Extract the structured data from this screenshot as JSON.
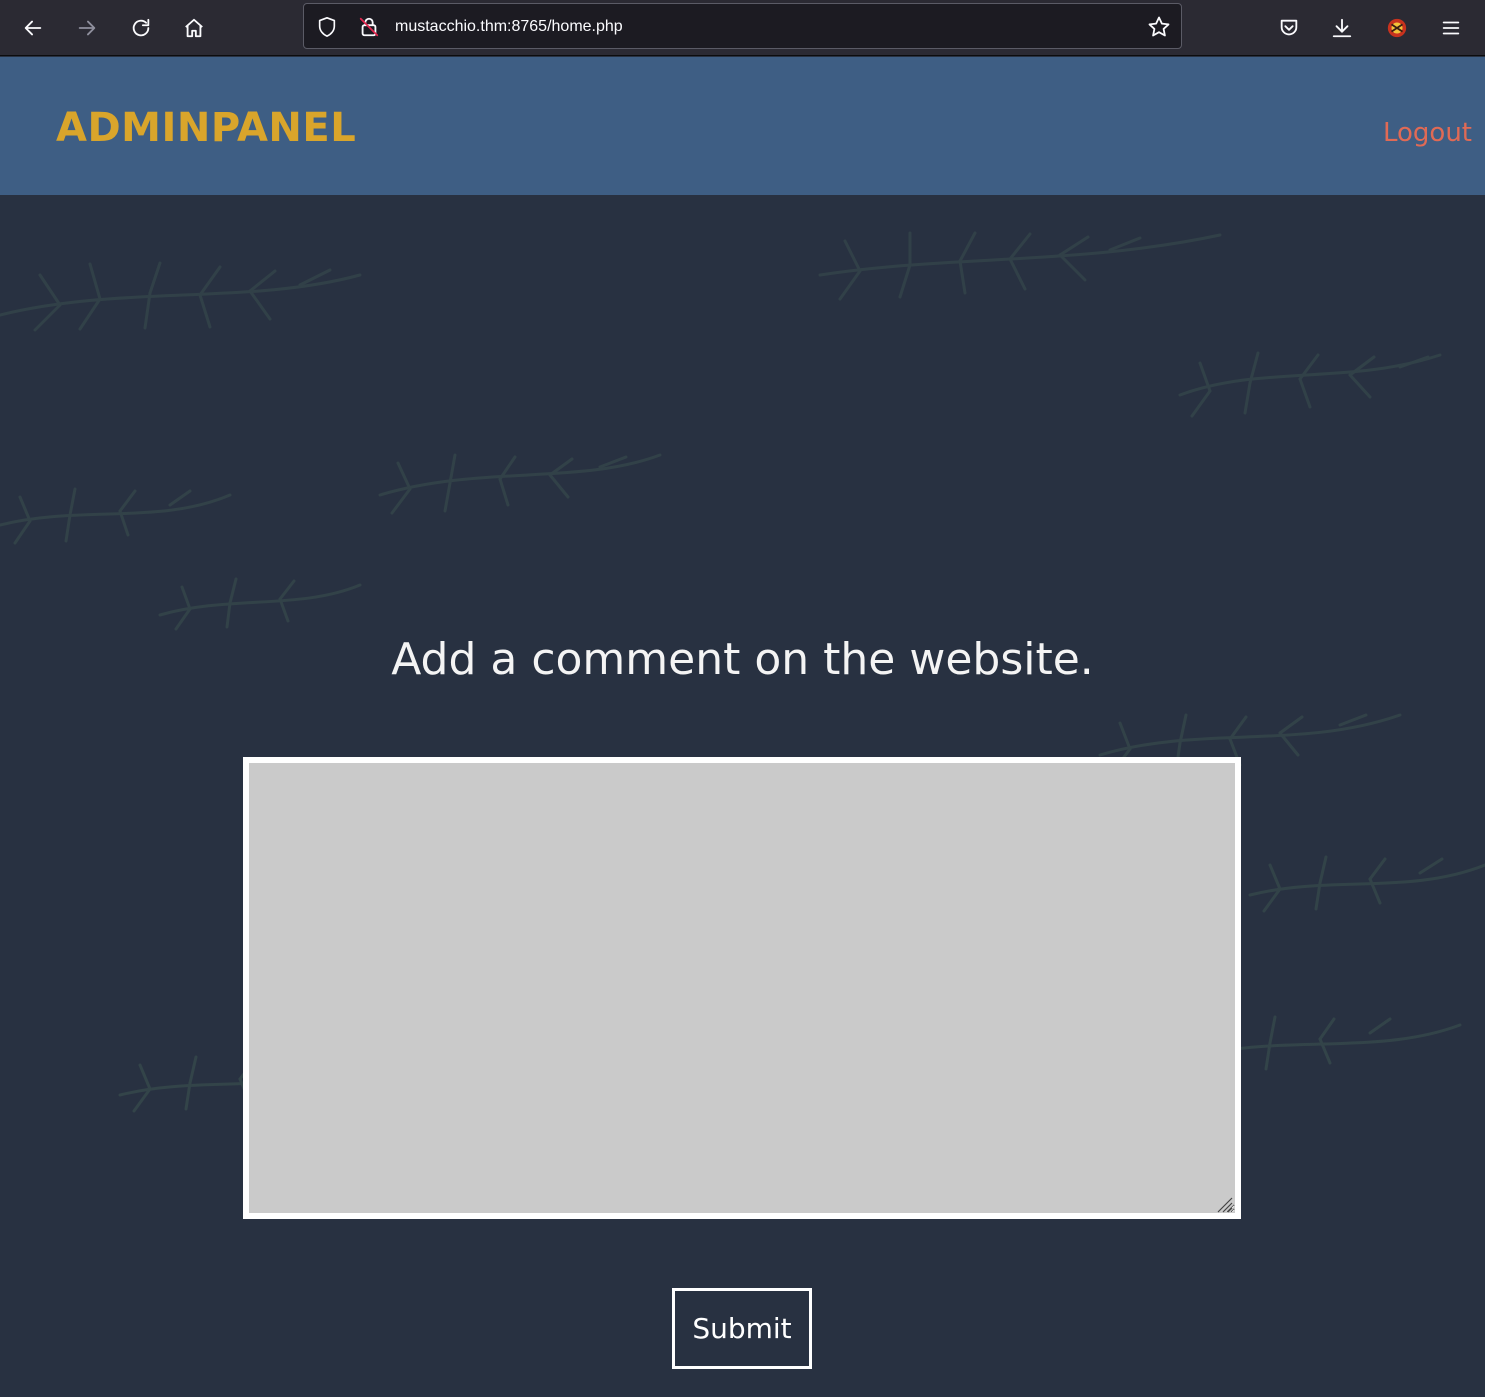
{
  "browser": {
    "url": "mustacchio.thm:8765/home.php",
    "buttons": {
      "back": "back-icon",
      "forward": "forward-icon",
      "reload": "reload-icon",
      "home": "home-icon",
      "pocket": "pocket-icon",
      "downloads": "download-icon",
      "extension": "extension-icon",
      "menu": "hamburger-menu-icon"
    }
  },
  "header": {
    "brand": "ADMINPANEL",
    "logout": "Logout"
  },
  "main": {
    "heading": "Add a comment on the website.",
    "comment": {
      "value": "",
      "placeholder": ""
    },
    "submit_label": "Submit"
  },
  "colors": {
    "header_bg": "#3e5e84",
    "brand": "#d9a52b",
    "logout": "#e06a55",
    "page_bg": "#283141",
    "textarea_bg": "#cacaca"
  }
}
